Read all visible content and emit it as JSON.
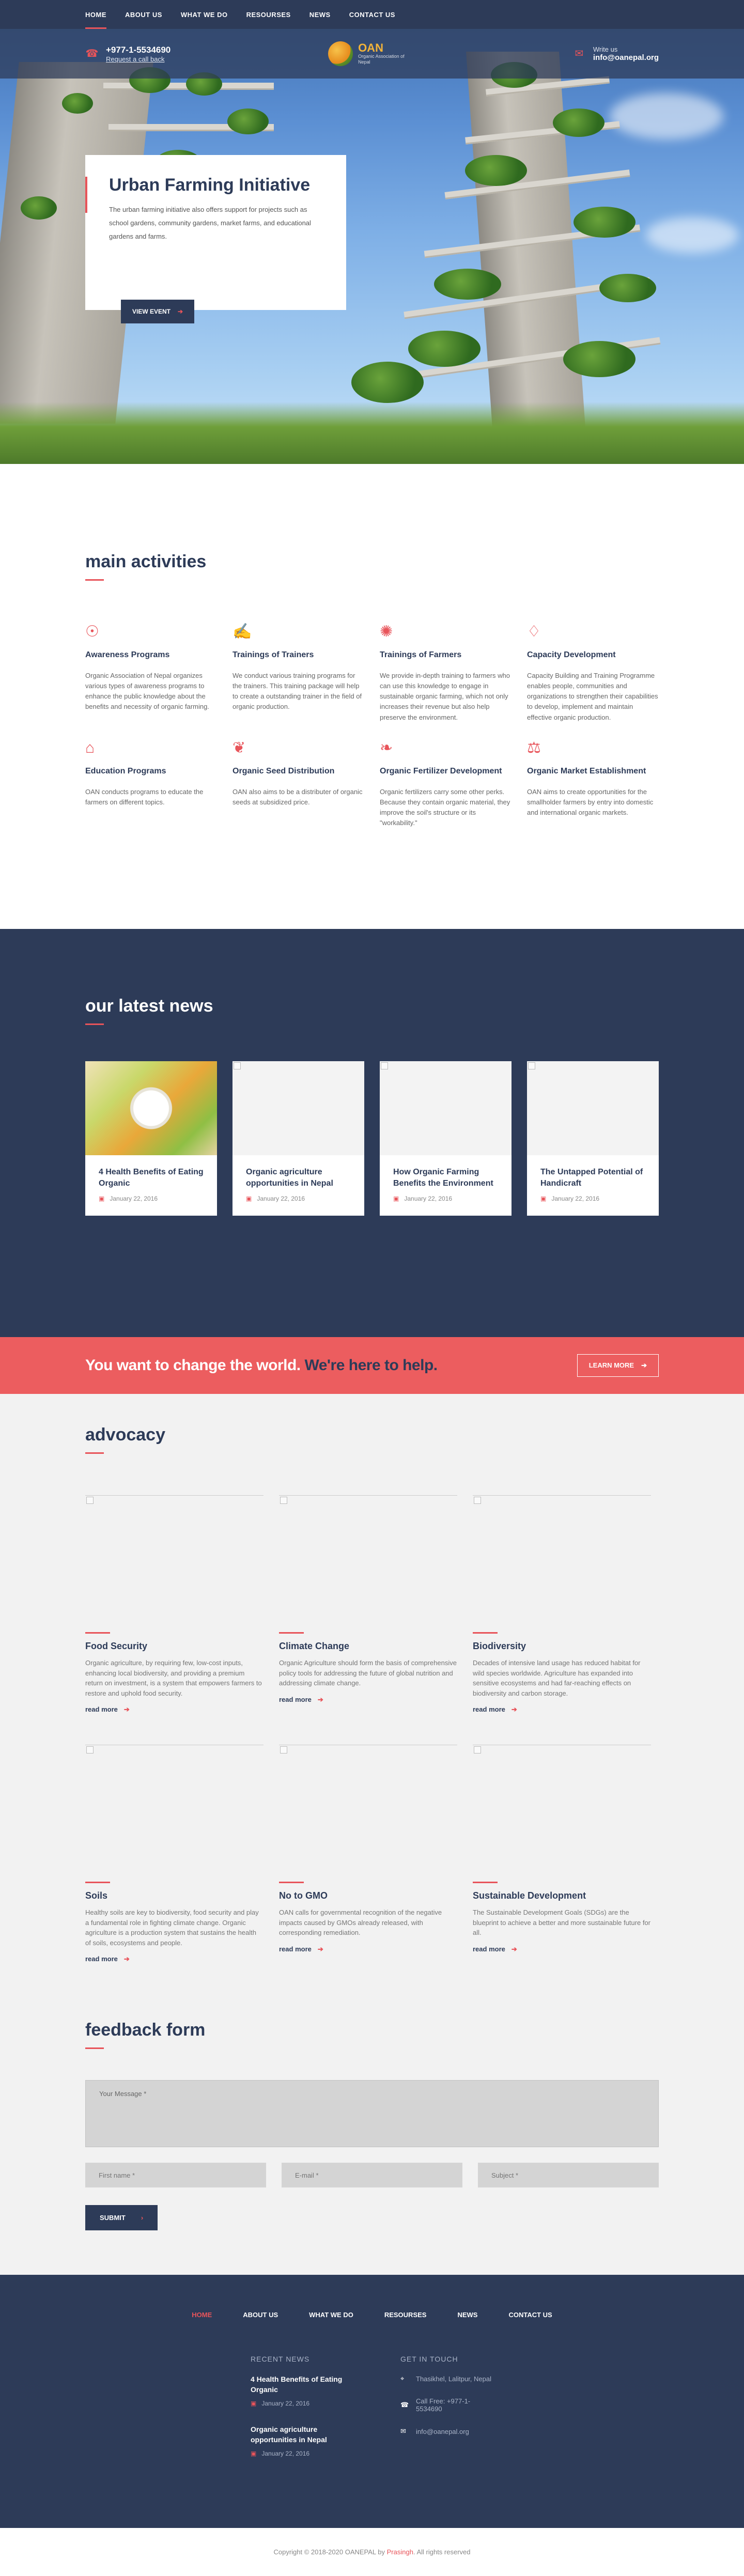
{
  "nav": {
    "items": [
      "HOME",
      "ABOUT US",
      "WHAT WE DO",
      "RESOURSES",
      "NEWS",
      "CONTACT US"
    ],
    "active": "HOME"
  },
  "contact_bar": {
    "phone": "+977-1-5534690",
    "phone_sub": "Request a call back",
    "logo_text": "OAN",
    "logo_sub": "Organic Association of Nepal",
    "write_label": "Write us",
    "email": "info@oanepal.org"
  },
  "hero": {
    "title": "Urban Farming Initiative",
    "text": "The urban farming initiative also offers support for projects such as school gardens, community gardens, market farms, and educational gardens and farms.",
    "button": "VIEW EVENT"
  },
  "activities": {
    "title": "main activities",
    "items": [
      {
        "icon": "awareness-icon",
        "title": "Awareness Programs",
        "text": "Organic Association of Nepal organizes various types of awareness programs to enhance the public knowledge about the benefits and necessity of organic farming."
      },
      {
        "icon": "trainers-icon",
        "title": "Trainings of Trainers",
        "text": "We conduct various training programs for the trainers. This training package will help to create a outstanding trainer in the field of organic production."
      },
      {
        "icon": "farmers-icon",
        "title": "Trainings of Farmers",
        "text": "We provide in-depth training to farmers who can use this knowledge to engage in sustainable organic farming, which not only increases their revenue but also help preserve the environment."
      },
      {
        "icon": "capacity-icon",
        "title": "Capacity Development",
        "text": "Capacity Building and Training Programme enables people, communities and organizations to strengthen their capabilities to develop, implement and maintain effective organic production."
      },
      {
        "icon": "education-icon",
        "title": "Education Programs",
        "text": "OAN conducts programs to educate the farmers on different topics."
      },
      {
        "icon": "seed-icon",
        "title": "Organic Seed Distribution",
        "text": "OAN also aims to be a distributer of organic seeds at subsidized price."
      },
      {
        "icon": "fertilizer-icon",
        "title": "Organic Fertilizer Development",
        "text": "Organic fertilizers carry some other perks. Because they contain organic material, they improve the soil's structure or its \"workability.\""
      },
      {
        "icon": "market-icon",
        "title": "Organic Market Establishment",
        "text": "OAN aims to create opportunities for the smallholder farmers by entry into domestic and international organic markets."
      }
    ]
  },
  "news": {
    "title": "our latest news",
    "items": [
      {
        "title": "4 Health Benefits of Eating Organic",
        "date": "January 22, 2016",
        "has_image": true
      },
      {
        "title": "Organic agriculture opportunities in Nepal",
        "date": "January 22, 2016",
        "has_image": false
      },
      {
        "title": "How Organic Farming Benefits the Environment",
        "date": "January 22, 2016",
        "has_image": false
      },
      {
        "title": "The Untapped Potential of Handicraft",
        "date": "January 22, 2016",
        "has_image": false
      }
    ]
  },
  "cta": {
    "text_light": "You want to change the world.",
    "text_dark": "We're here to help.",
    "button": "LEARN MORE"
  },
  "advocacy": {
    "title": "advocacy",
    "read_more": "read more",
    "items": [
      {
        "title": "Food Security",
        "text": "Organic agriculture, by requiring few, low-cost inputs, enhancing local biodiversity, and providing a premium return on investment, is a system that empowers farmers to restore and uphold food security."
      },
      {
        "title": "Climate Change",
        "text": "Organic Agriculture should form the basis of comprehensive policy tools for addressing the future of global nutrition and addressing climate change."
      },
      {
        "title": "Biodiversity",
        "text": "Decades of intensive land usage has reduced habitat for wild species worldwide. Agriculture has expanded into sensitive ecosystems and had far-reaching effects on biodiversity and carbon storage."
      },
      {
        "title": "Soils",
        "text": "Healthy soils are key to biodiversity, food security and play a fundamental role in fighting climate change. Organic agriculture is a production system that sustains the health of soils, ecosystems and people."
      },
      {
        "title": "No to GMO",
        "text": "OAN calls for governmental recognition of the negative impacts caused by GMOs already released, with corresponding remediation."
      },
      {
        "title": "Sustainable Development",
        "text": "The Sustainable Development Goals (SDGs) are the blueprint to achieve a better and more sustainable future for all."
      }
    ]
  },
  "feedback": {
    "title": "feedback form",
    "message_placeholder": "Your Message *",
    "first_name_placeholder": "First name *",
    "email_placeholder": "E-mail *",
    "subject_placeholder": "Subject *",
    "submit": "SUBMIT"
  },
  "footer": {
    "nav": [
      "HOME",
      "ABOUT US",
      "WHAT WE DO",
      "RESOURSES",
      "NEWS",
      "CONTACT US"
    ],
    "recent_news_heading": "RECENT NEWS",
    "recent_news": [
      {
        "title": "4 Health Benefits of Eating Organic",
        "date": "January 22, 2016"
      },
      {
        "title": "Organic agriculture opportunities in Nepal",
        "date": "January 22, 2016"
      }
    ],
    "get_in_touch_heading": "GET IN TOUCH",
    "address": "Thasikhel, Lalitpur, Nepal",
    "phone": "Call Free: +977-1-5534690",
    "email": "info@oanepal.org"
  },
  "copyright": {
    "prefix": "Copyright © 2018-2020 OANEPAL by",
    "brand": "Prasingh",
    "suffix": ". All rights reserved"
  },
  "colors": {
    "navy": "#2d3b58",
    "accent": "#e8545a",
    "light_bg": "#f2f2f2"
  }
}
